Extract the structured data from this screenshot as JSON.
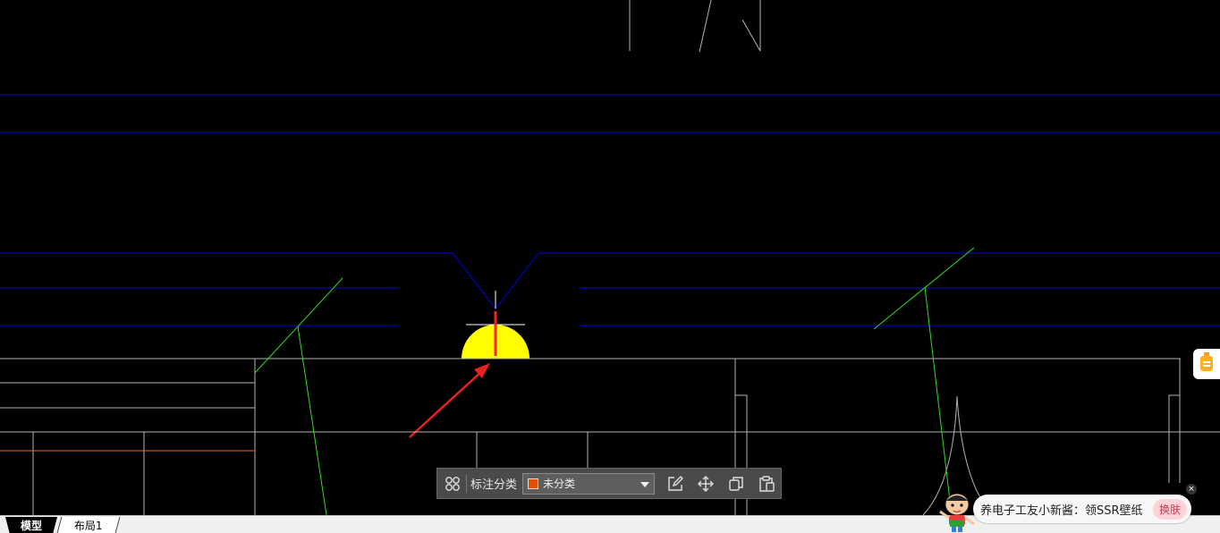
{
  "colors": {
    "background": "#000000",
    "blue_lines": "#0000e0",
    "white_lines": "#b4b4b4",
    "green_lines": "#33dd22",
    "orange_line": "#e07030",
    "yellow_fill": "#ffff00",
    "red_mark": "#ff2020",
    "category_swatch": "#e05000"
  },
  "toolbar": {
    "label": "标注分类",
    "category_value": "未分类",
    "icons": [
      "grid-icon",
      "chevron-down-icon",
      "edit-icon",
      "move-icon",
      "copy-icon",
      "paste-icon"
    ]
  },
  "tabs": {
    "model": "模型",
    "layout1": "布局1"
  },
  "ad": {
    "text": "养电子工友小新酱：领SSR壁纸",
    "button": "换肤",
    "close": "×"
  },
  "side_widget": {
    "icon": "bottle-icon"
  }
}
